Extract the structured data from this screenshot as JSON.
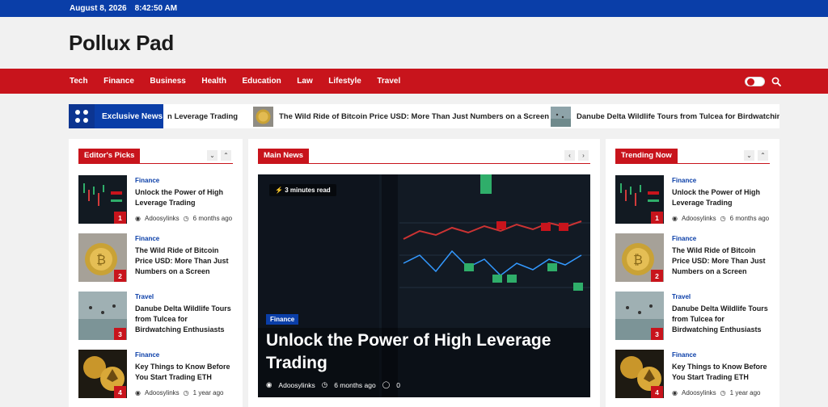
{
  "topbar": {
    "date": "August 8, 2026",
    "time": "8:42:50 AM"
  },
  "site": {
    "title": "Pollux Pad"
  },
  "nav": {
    "items": [
      "Tech",
      "Finance",
      "Business",
      "Health",
      "Education",
      "Law",
      "Lifestyle",
      "Travel"
    ]
  },
  "ticker": {
    "label": "Exclusive News",
    "items": [
      "n Leverage Trading",
      "The Wild Ride of Bitcoin Price USD: More Than Just Numbers on a Screen",
      "Danube Delta Wildlife Tours from Tulcea for Birdwatching"
    ]
  },
  "editors": {
    "title": "Editor's Picks",
    "items": [
      {
        "num": "1",
        "cat": "Finance",
        "title": "Unlock the Power of High Leverage Trading",
        "author": "Adoosylinks",
        "time": "6 months ago"
      },
      {
        "num": "2",
        "cat": "Finance",
        "title": "The Wild Ride of Bitcoin Price USD: More Than Just Numbers on a Screen"
      },
      {
        "num": "3",
        "cat": "Travel",
        "title": "Danube Delta Wildlife Tours from Tulcea for Birdwatching Enthusiasts"
      },
      {
        "num": "4",
        "cat": "Finance",
        "title": "Key Things to Know Before You Start Trading ETH",
        "author": "Adoosylinks",
        "time": "1 year ago"
      }
    ]
  },
  "main": {
    "title": "Main News",
    "feature": {
      "read_time": "3 minutes read",
      "cat": "Finance",
      "title": "Unlock the Power of High Leverage Trading",
      "author": "Adoosylinks",
      "time": "6 months ago",
      "comments": "0"
    }
  },
  "trending": {
    "title": "Trending Now",
    "items": [
      {
        "num": "1",
        "cat": "Finance",
        "title": "Unlock the Power of High Leverage Trading",
        "author": "Adoosylinks",
        "time": "6 months ago"
      },
      {
        "num": "2",
        "cat": "Finance",
        "title": "The Wild Ride of Bitcoin Price USD: More Than Just Numbers on a Screen"
      },
      {
        "num": "3",
        "cat": "Travel",
        "title": "Danube Delta Wildlife Tours from Tulcea for Birdwatching Enthusiasts"
      },
      {
        "num": "4",
        "cat": "Finance",
        "title": "Key Things to Know Before You Start Trading ETH",
        "author": "Adoosylinks",
        "time": "1 year ago"
      }
    ]
  },
  "icons": {
    "search": "search-icon",
    "grid": "grid-dots-icon",
    "user": "user-icon",
    "clock": "clock-icon",
    "comment": "comment-icon",
    "bolt": "bolt-icon"
  },
  "colors": {
    "brand_blue": "#0a3ea8",
    "brand_red": "#c8141c"
  }
}
